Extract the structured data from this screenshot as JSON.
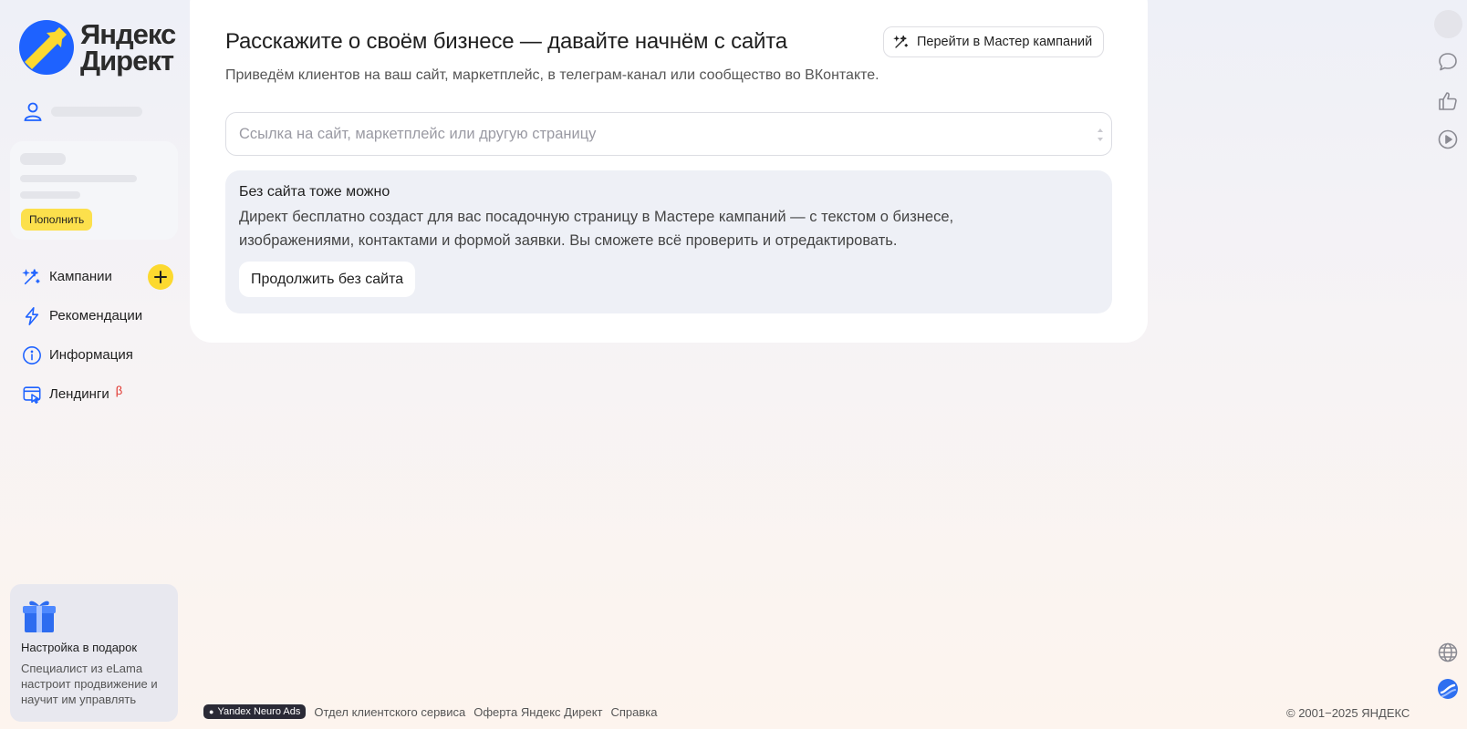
{
  "brand": {
    "logo_line1": "Яндекс",
    "logo_line2": "Директ",
    "logo_colors": {
      "primary": "#1e62ff",
      "accent": "#fcd92f"
    }
  },
  "sidebar": {
    "topup_label": "Пополнить",
    "nav": [
      {
        "label": "Кампании",
        "icon": "magic-wand-icon"
      },
      {
        "label": "Рекомендации",
        "icon": "lightning-icon"
      },
      {
        "label": "Информация",
        "icon": "info-icon"
      },
      {
        "label": "Лендинги",
        "icon": "landing-page-icon",
        "badge": "β"
      }
    ],
    "promo": {
      "title": "Настройка в подарок",
      "description": "Специалист из eLama настроит продвижение и научит им управлять",
      "icon": "gift-icon"
    }
  },
  "main": {
    "heading": "Расскажите о своём бизнесе — давайте начнём с сайта",
    "subheading": "Приведём клиентов на ваш сайт, маркетплейс, в телеграм-канал или сообщество во ВКонтакте.",
    "wizard_button": "Перейти в Мастер кампаний",
    "url_input": {
      "placeholder": "Ссылка на сайт, маркетплейс или другую страницу",
      "value": ""
    },
    "no_site": {
      "title": "Без сайта тоже можно",
      "description": "Директ бесплатно создаст для вас посадочную страницу в Мастере кампаний — с текстом о бизнесе, изображениями, контактами и формой заявки. Вы сможете всё проверить и отредактировать.",
      "button": "Продолжить без сайта"
    }
  },
  "right_rail": {
    "icons": [
      "chat-icon",
      "thumbs-up-icon",
      "play-icon",
      "globe-icon",
      "assistant-icon"
    ]
  },
  "footer": {
    "badge": "Yandex Neuro Ads",
    "links": [
      "Отдел клиентского сервиса",
      "Оферта Яндекс Директ",
      "Справка"
    ],
    "copyright": "© 2001−2025 ЯНДЕКС"
  }
}
